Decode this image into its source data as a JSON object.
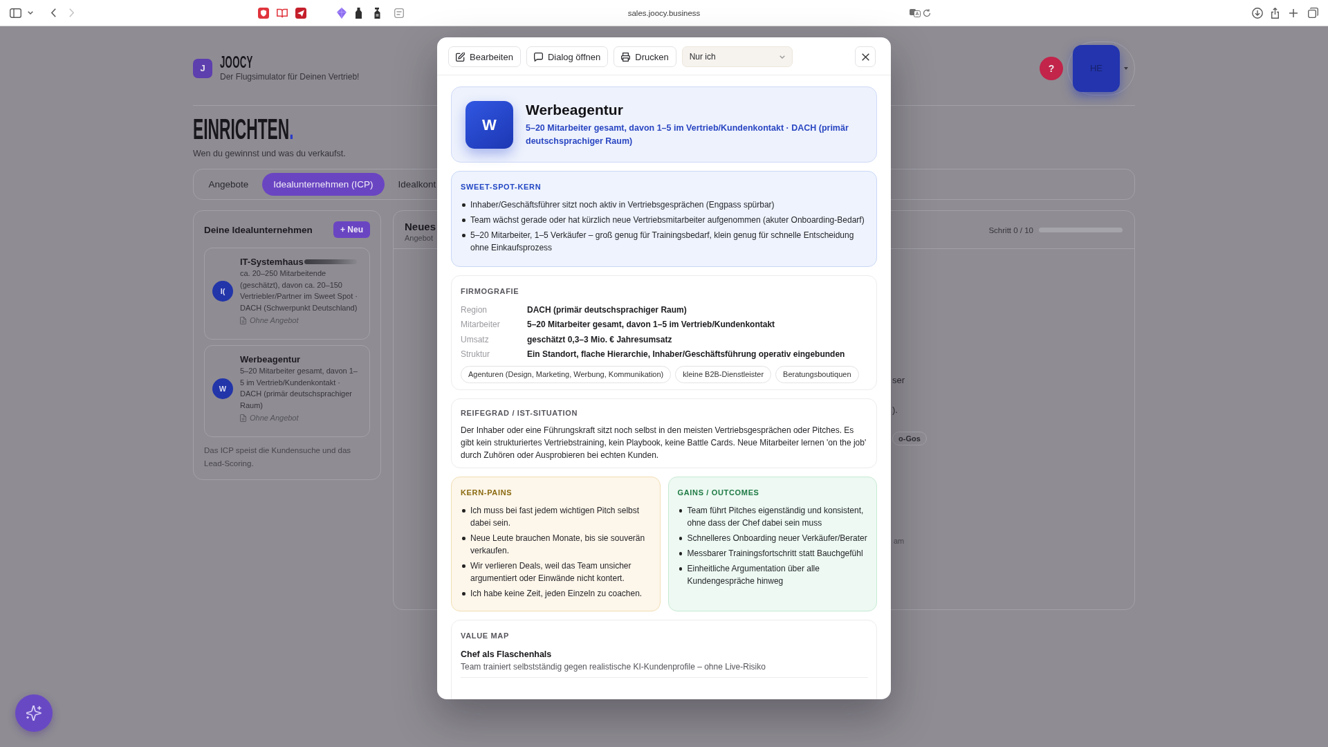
{
  "browser": {
    "url": "sales.joocy.business"
  },
  "header": {
    "logo_letter": "J",
    "brand": "JOOCY",
    "tagline": "Der Flugsimulator für Deinen Vertrieb!",
    "help": "?",
    "avatar": "HE"
  },
  "intro": {
    "title": "EINRICHTEN",
    "title_accent": ".",
    "subtitle": "Wen du gewinnst und was du verkaufst."
  },
  "tabs": [
    {
      "label": "Angebote",
      "selected": false
    },
    {
      "label": "Idealunternehmen (ICP)",
      "selected": true
    },
    {
      "label": "Idealkont",
      "selected": false
    }
  ],
  "icp_panel": {
    "title": "Deine Idealunternehmen",
    "new_button": "+ Neu",
    "items": [
      {
        "initials": "I(",
        "name": "IT-Systemhaus",
        "redacted": true,
        "description": "ca. 20–250 Mitarbeitende (geschätzt), davon ca. 20–150 Vertriebler/Partner im Sweet Spot · DACH (Schwerpunkt Deutschland)",
        "offer": "Ohne Angebot"
      },
      {
        "initials": "W",
        "name": "Werbeagentur",
        "redacted": false,
        "description": "5–20 Mitarbeiter gesamt, davon 1–5 im Vertrieb/Kundenkontakt · DACH (primär deutschsprachiger Raum)",
        "offer": "Ohne Angebot"
      }
    ],
    "footer": "Das ICP speist die Kundensuche und das Lead-Scoring."
  },
  "offer_panel": {
    "title": "Neues",
    "subtitle": "Angebot",
    "step": "Schritt 0 / 10",
    "level": 0,
    "fragments": [
      {
        "kind": "text",
        "text": "ser"
      },
      {
        "kind": "text",
        "text": ")."
      },
      {
        "kind": "chip",
        "text": "o-Gos"
      },
      {
        "kind": "note",
        "text": "am"
      }
    ]
  },
  "modal": {
    "actions": [
      {
        "kind": "edit",
        "label": "Bearbeiten"
      },
      {
        "kind": "chat",
        "label": "Dialog öffnen"
      },
      {
        "kind": "print",
        "label": "Drucken"
      }
    ],
    "visibility": "Nur ich",
    "profile": {
      "initial": "W",
      "title": "Werbeagentur",
      "summary": "5–20 Mitarbeiter gesamt, davon 1–5 im Vertrieb/Kundenkontakt · DACH (primär deutschsprachiger Raum)"
    },
    "sections": [
      {
        "kind": "sweetspot",
        "heading": "SWEET-SPOT-KERN",
        "items": [
          "Inhaber/Geschäftsführer sitzt noch aktiv in Vertriebsgesprächen (Engpass spürbar)",
          "Team wächst gerade oder hat kürzlich neue Vertriebsmitarbeiter aufgenommen (akuter Onboarding-Bedarf)",
          "5–20 Mitarbeiter, 1–5 Verkäufer – groß genug für Trainingsbedarf, klein genug für schnelle Entscheidung ohne Einkaufsprozess"
        ]
      },
      {
        "kind": "facts",
        "heading": "FIRMOGRAFIE",
        "facts": [
          {
            "label": "Region",
            "value": "DACH (primär deutschsprachiger Raum)"
          },
          {
            "label": "Mitarbeiter",
            "value": "5–20 Mitarbeiter gesamt, davon 1–5 im Vertrieb/Kundenkontakt"
          },
          {
            "label": "Umsatz",
            "value": "geschätzt 0,3–3 Mio. € Jahresumsatz"
          },
          {
            "label": "Struktur",
            "value": "Ein Standort, flache Hierarchie, Inhaber/Geschäftsführung operativ eingebunden"
          }
        ],
        "tags": [
          "Agenturen (Design, Marketing, Werbung, Kommunikation)",
          "kleine B2B-Dienstleister",
          "Beratungsboutiquen"
        ]
      },
      {
        "kind": "text",
        "heading": "REIFEGRAD / IST-SITUATION",
        "text": "Der Inhaber oder eine Führungskraft sitzt noch selbst in den meisten Vertriebsgesprächen oder Pitches. Es gibt kein strukturiertes Vertriebstraining, kein Playbook, keine Battle Cards. Neue Mitarbeiter lernen 'on the job' durch Zuhören oder Ausprobieren bei echten Kunden."
      },
      {
        "kind": "pains",
        "heading": "KERN-PAINS",
        "items": [
          "Ich muss bei fast jedem wichtigen Pitch selbst dabei sein.",
          "Neue Leute brauchen Monate, bis sie souverän verkaufen.",
          "Wir verlieren Deals, weil das Team unsicher argumentiert oder Einwände nicht kontert.",
          "Ich habe keine Zeit, jeden Einzeln zu coachen."
        ]
      },
      {
        "kind": "gains",
        "heading": "GAINS / OUTCOMES",
        "items": [
          "Team führt Pitches eigenständig und konsistent, ohne dass der Chef dabei sein muss",
          "Schnelleres Onboarding neuer Verkäufer/Berater",
          "Messbarer Trainingsfortschritt statt Bauchgefühl",
          "Einheitliche Argumentation über alle Kundengespräche hinweg"
        ]
      },
      {
        "kind": "valuemap",
        "heading": "VALUE MAP",
        "entries": [
          {
            "title": "Chef als Flaschenhals",
            "text": "Team trainiert selbstständig gegen realistische KI-Kundenprofile – ohne Live-Risiko"
          }
        ]
      }
    ]
  }
}
